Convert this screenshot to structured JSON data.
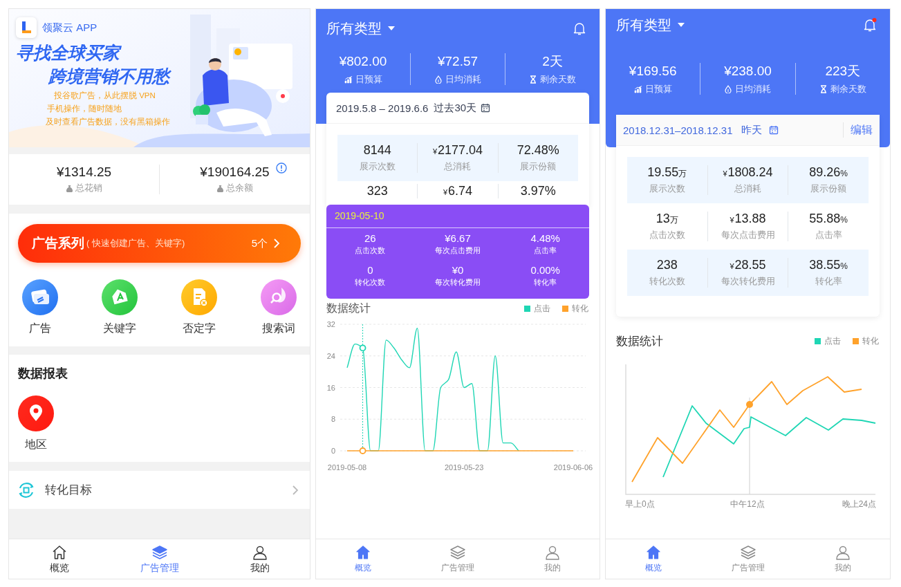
{
  "screens": [
    {
      "kind": "management",
      "banner": {
        "brand": "领聚云 APP",
        "headline": [
          "寻找全球买家",
          "跨境营销不用愁"
        ],
        "points": [
          "投谷歌广告，从此摆脱 VPN",
          "手机操作，随时随地",
          "及时查看广告数据，没有黑箱操作"
        ]
      },
      "totals": [
        {
          "value": "¥1314.25",
          "label": "总花销"
        },
        {
          "value": "¥190164.25",
          "label": "总余额"
        }
      ],
      "campaign_button": {
        "title": "广告系列",
        "hint": "( 快速创建广告、关键字)",
        "count": "5个"
      },
      "shortcuts": [
        {
          "kind": "ad",
          "label": "广告"
        },
        {
          "kind": "keyword",
          "label": "关键字"
        },
        {
          "kind": "negative",
          "label": "否定字"
        },
        {
          "kind": "search",
          "label": "搜索词"
        }
      ],
      "reports": {
        "title": "数据报表",
        "items": [
          {
            "kind": "region",
            "label": "地区"
          }
        ]
      },
      "goal_row": {
        "label": "转化目标"
      },
      "tab_bar": [
        {
          "kind": "home",
          "label": "概览",
          "selected": false
        },
        {
          "kind": "layers",
          "label": "广告管理",
          "selected": true
        },
        {
          "kind": "user",
          "label": "我的",
          "selected": false
        }
      ]
    },
    {
      "kind": "overview",
      "header": {
        "title": "所有类型",
        "notification_dot": false
      },
      "stats": [
        {
          "kind": "budget",
          "value": "¥802.00",
          "label": "日预算"
        },
        {
          "kind": "spend",
          "value": "¥72.57",
          "label": "日均消耗"
        },
        {
          "kind": "days",
          "value": "2天",
          "label": "剩余天数"
        }
      ],
      "date_range": {
        "dates": "2019.5.8 – 2019.6.6",
        "period": "过去30天"
      },
      "metric_rows": [
        {
          "shaded": true,
          "cells": [
            {
              "value": "8144",
              "label": "展示次数"
            },
            {
              "prefix": "¥",
              "value": "2177.04",
              "label": "总消耗"
            },
            {
              "value": "72.48%",
              "label": "展示份额"
            }
          ]
        },
        {
          "shaded": false,
          "cells": [
            {
              "value": "323"
            },
            {
              "prefix": "¥",
              "value": "6.74"
            },
            {
              "value": "3.97%"
            }
          ]
        }
      ],
      "tooltip": {
        "date": "2019-05-10",
        "items": [
          {
            "value": "26",
            "label": "点击次数"
          },
          {
            "value": "¥6.67",
            "label": "每次点击费用"
          },
          {
            "value": "4.48%",
            "label": "点击率"
          },
          {
            "value": "0",
            "label": "转化次数"
          },
          {
            "value": "¥0",
            "label": "每次转化费用"
          },
          {
            "value": "0.00%",
            "label": "转化率"
          }
        ]
      },
      "chart": {
        "chart_data": {
          "type": "line",
          "title": "数据统计",
          "categories": [
            "2019-05-08",
            null,
            null,
            null,
            null,
            null,
            null,
            null,
            null,
            null,
            null,
            null,
            null,
            null,
            null,
            "2019-05-23",
            null,
            null,
            null,
            null,
            null,
            null,
            null,
            null,
            null,
            null,
            null,
            null,
            null,
            "2019-06-06"
          ],
          "ylim": [
            0,
            32
          ],
          "yticks": [
            0,
            8,
            16,
            24,
            32
          ],
          "grid": true,
          "series": [
            {
              "name": "点击",
              "color": "#1fd6b4",
              "values": [
                21,
                27,
                26,
                0,
                0,
                28,
                26,
                23,
                21,
                31,
                0,
                0,
                16,
                18,
                25,
                16,
                17,
                0,
                0,
                24,
                2,
                2,
                0,
                null,
                null,
                null,
                null,
                null,
                null,
                null
              ]
            },
            {
              "name": "转化",
              "color": "#ffa22b",
              "values": [
                0,
                0,
                0,
                0,
                0,
                0,
                0,
                0,
                0,
                0,
                0,
                0,
                0,
                0,
                0,
                0,
                0,
                0,
                0,
                0,
                0,
                0,
                0,
                0,
                0,
                0,
                0,
                0,
                0,
                0
              ]
            }
          ]
        }
      },
      "tab_bar": [
        {
          "kind": "home",
          "label": "概览",
          "selected": true
        },
        {
          "kind": "layers",
          "label": "广告管理",
          "selected": false
        },
        {
          "kind": "user",
          "label": "我的",
          "selected": false
        }
      ]
    },
    {
      "kind": "overview",
      "header": {
        "title": "所有类型",
        "notification_dot": true
      },
      "stats": [
        {
          "kind": "budget",
          "value": "¥169.56",
          "label": "日预算"
        },
        {
          "kind": "spend",
          "value": "¥238.00",
          "label": "日均消耗"
        },
        {
          "kind": "days",
          "value": "223天",
          "label": "剩余天数"
        }
      ],
      "date_range": {
        "dates": "2018.12.31–2018.12.31",
        "period": "昨天",
        "edit": "编辑"
      },
      "metric_rows": [
        {
          "shaded": true,
          "cells": [
            {
              "value": "19.55",
              "unit": "万",
              "label": "展示次数"
            },
            {
              "prefix": "¥",
              "value": "1808.24",
              "label": "总消耗"
            },
            {
              "value": "89.26",
              "unit": "%",
              "label": "展示份额"
            }
          ]
        },
        {
          "shaded": false,
          "cells": [
            {
              "value": "13",
              "unit": "万",
              "label": "点击次数"
            },
            {
              "prefix": "¥",
              "value": "13.88",
              "label": "每次点击费用"
            },
            {
              "value": "55.88",
              "unit": "%",
              "label": "点击率"
            }
          ]
        },
        {
          "shaded": true,
          "cells": [
            {
              "value": "238",
              "label": "转化次数"
            },
            {
              "prefix": "¥",
              "value": "28.55",
              "label": "每次转化费用"
            },
            {
              "value": "38.55",
              "unit": "%",
              "label": "转化率"
            }
          ]
        }
      ],
      "chart": {
        "title": "数据统计",
        "legend": [
          {
            "label": "点击",
            "color": "#1fd6b4"
          },
          {
            "label": "转化",
            "color": "#ffa22b"
          }
        ],
        "x_labels": [
          "早上0点",
          "中午12点",
          "晚上24点"
        ]
      },
      "tab_bar": [
        {
          "kind": "home",
          "label": "概览",
          "selected": true
        },
        {
          "kind": "layers",
          "label": "广告管理",
          "selected": false
        },
        {
          "kind": "user",
          "label": "我的",
          "selected": false
        }
      ]
    }
  ]
}
